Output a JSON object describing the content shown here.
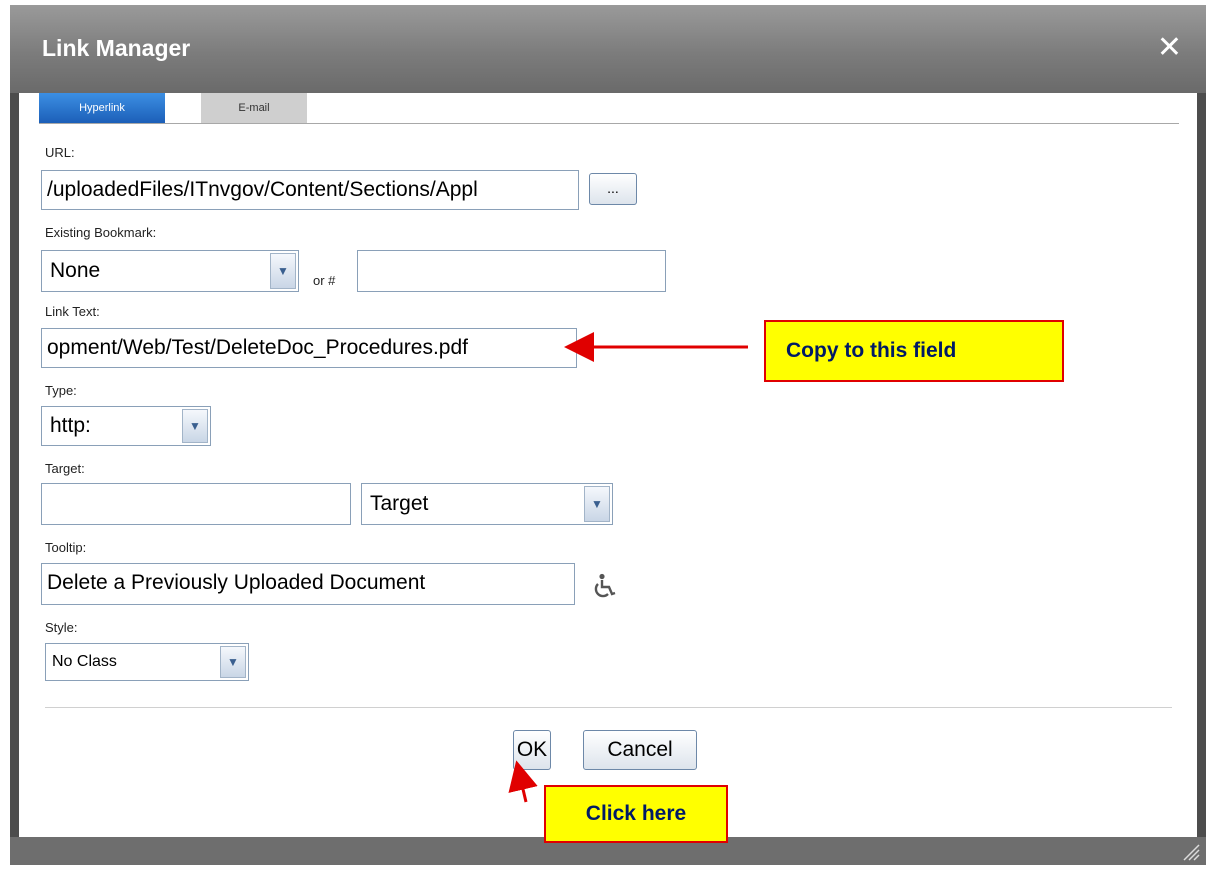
{
  "dialog": {
    "title": "Link Manager"
  },
  "tabs": {
    "hyperlink": "Hyperlink",
    "email": "E-mail"
  },
  "url": {
    "label": "URL:",
    "value": "/uploadedFiles/ITnvgov/Content/Sections/Appl",
    "browse_label": "..."
  },
  "bookmark": {
    "label": "Existing Bookmark:",
    "selected": "None",
    "or_label": "or #",
    "anchor_value": ""
  },
  "link_text": {
    "label": "Link Text:",
    "value": "opment/Web/Test/DeleteDoc_Procedures.pdf"
  },
  "type": {
    "label": "Type:",
    "selected": "http:"
  },
  "target": {
    "label": "Target:",
    "value": "",
    "selected": "Target"
  },
  "tooltip": {
    "label": "Tooltip:",
    "value": "Delete a Previously Uploaded Document"
  },
  "style": {
    "label": "Style:",
    "selected": "No Class"
  },
  "buttons": {
    "ok": "OK",
    "cancel": "Cancel"
  },
  "annotations": {
    "copy": "Copy to this field",
    "click": "Click here"
  },
  "colors": {
    "annotation_fill": "#ffff00",
    "annotation_border": "#e00000",
    "annotation_arrow": "#e00000",
    "tab_active": "#1c5fb8"
  },
  "icons": {
    "close": "close-icon",
    "accessibility": "accessibility-icon",
    "dropdown": "chevron-down-icon",
    "resize": "resize-grip-icon"
  }
}
